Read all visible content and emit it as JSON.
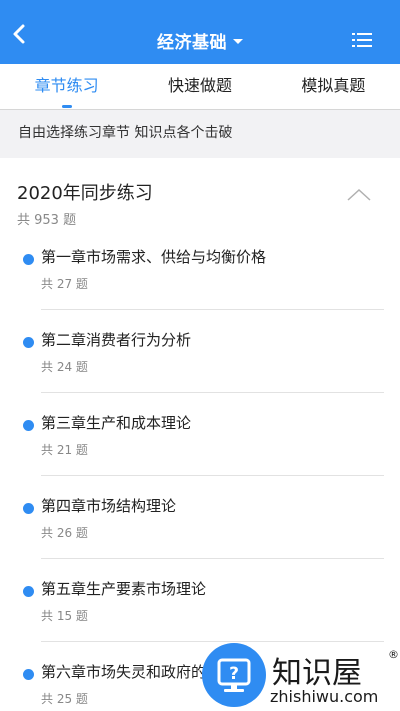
{
  "header": {
    "title": "经济基础",
    "back_icon": "chevron-left-icon",
    "menu_icon": "list-menu-icon",
    "bg_color": "#2f8cf2"
  },
  "tabs": [
    {
      "label": "章节练习",
      "active": true
    },
    {
      "label": "快速做题",
      "active": false
    },
    {
      "label": "模拟真题",
      "active": false
    }
  ],
  "hint": "自由选择练习章节 知识点各个击破",
  "section": {
    "title": "2020年同步练习",
    "count": "共 953 题",
    "collapse_icon": "chevron-up-icon",
    "chapters": [
      {
        "name": "第一章市场需求、供给与均衡价格",
        "count": "共 27 题"
      },
      {
        "name": "第二章消费者行为分析",
        "count": "共 24 题"
      },
      {
        "name": "第三章生产和成本理论",
        "count": "共 21 题"
      },
      {
        "name": "第四章市场结构理论",
        "count": "共 26 题"
      },
      {
        "name": "第五章生产要素市场理论",
        "count": "共 15 题"
      },
      {
        "name": "第六章市场失灵和政府的",
        "count": "共 25 题"
      }
    ]
  },
  "watermark": {
    "brand": "知识屋",
    "reg_mark": "®",
    "url": "zhishiwu.com",
    "icon": "question-monitor-icon"
  }
}
